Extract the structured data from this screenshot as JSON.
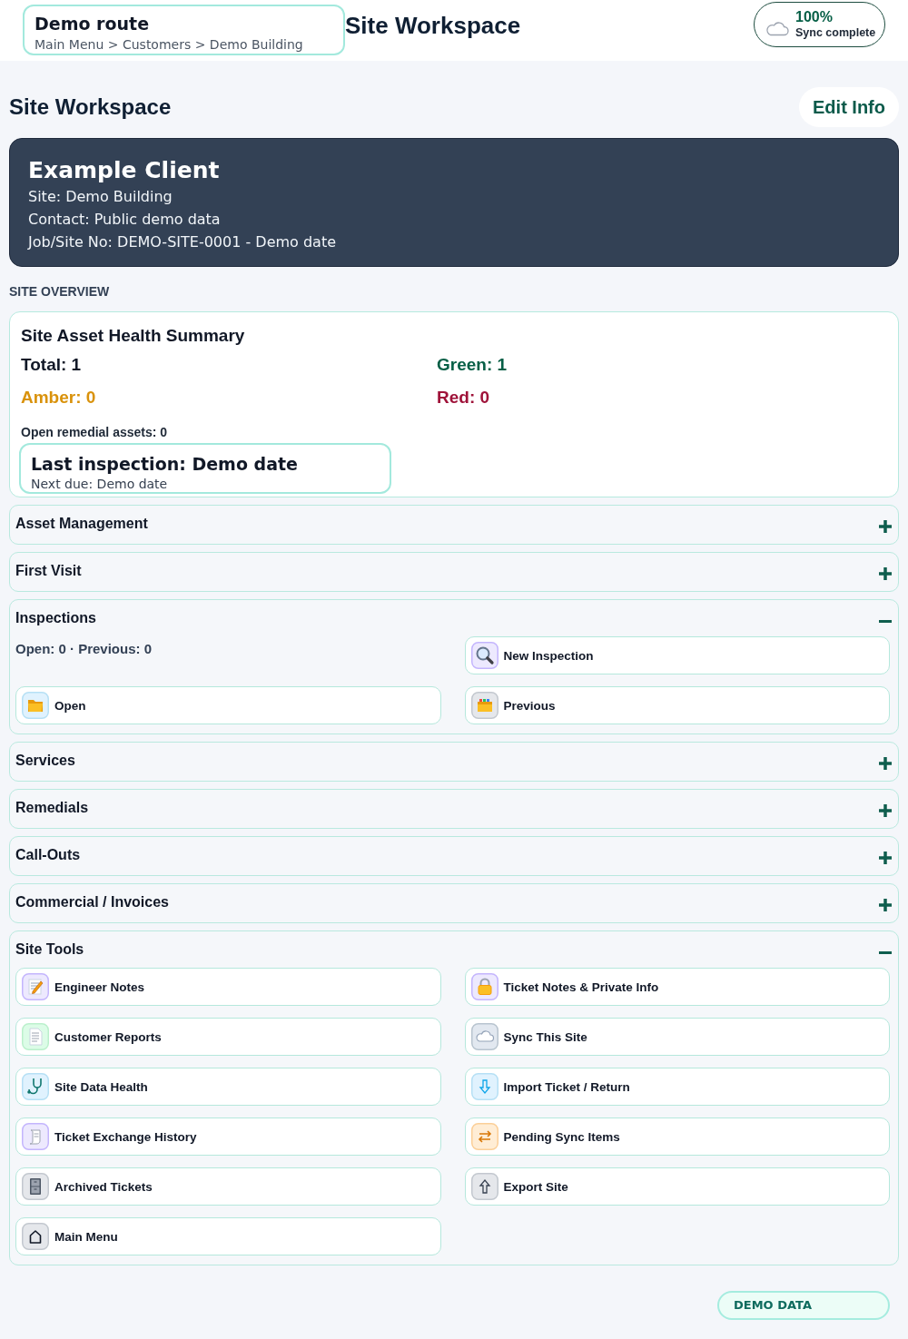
{
  "header": {
    "route_card": {
      "title": "Demo route",
      "breadcrumb": "Main Menu > Customers > Demo Building"
    },
    "title": "Site Workspace",
    "sync_status": {
      "percent": "100%",
      "label": "Sync complete"
    }
  },
  "page": {
    "title": "Site Workspace",
    "edit_button": "Edit Info"
  },
  "client_card": {
    "name": "Example Client",
    "lines": [
      "Site: Demo Building",
      "Contact: Public demo data",
      "Job/Site No: DEMO-SITE-0001 - Demo date"
    ]
  },
  "overview_label": "SITE OVERVIEW",
  "health_summary": {
    "title": "Site Asset Health Summary",
    "stats": [
      {
        "label": "Total: 1",
        "color": "#111827"
      },
      {
        "label": "Green: 1",
        "color": "#065f46"
      },
      {
        "label": "Amber: 0",
        "color": "#d9920b"
      },
      {
        "label": "Red: 0",
        "color": "#9f1239"
      }
    ],
    "open_remedial": "Open remedial assets: 0",
    "last_inspection": {
      "title": "Last inspection: Demo date",
      "next_due": "Next due: Demo date"
    }
  },
  "sections": [
    {
      "title": "Asset Management",
      "expanded": false
    },
    {
      "title": "First Visit",
      "expanded": false
    },
    {
      "title": "Inspections",
      "expanded": true,
      "summary": "Open: 0 · Previous: 0",
      "buttons": [
        {
          "label": "New Inspection"
        },
        {
          "label": "Open"
        },
        {
          "label": "Previous"
        }
      ]
    },
    {
      "title": "Services",
      "expanded": false
    },
    {
      "title": "Remedials",
      "expanded": false
    },
    {
      "title": "Call-Outs",
      "expanded": false
    },
    {
      "title": "Commercial / Invoices",
      "expanded": false
    },
    {
      "title": "Site Tools",
      "expanded": true,
      "buttons": [
        {
          "label": "Engineer Notes"
        },
        {
          "label": "Ticket Notes & Private Info"
        },
        {
          "label": "Customer Reports"
        },
        {
          "label": "Sync This Site"
        },
        {
          "label": "Site Data Health"
        },
        {
          "label": "Import Ticket / Return"
        },
        {
          "label": "Ticket Exchange History"
        },
        {
          "label": "Pending Sync Items"
        },
        {
          "label": "Archived Tickets"
        },
        {
          "label": "Export Site"
        },
        {
          "label": "Main Menu"
        }
      ]
    }
  ],
  "footer_badge": "DEMO DATA"
}
